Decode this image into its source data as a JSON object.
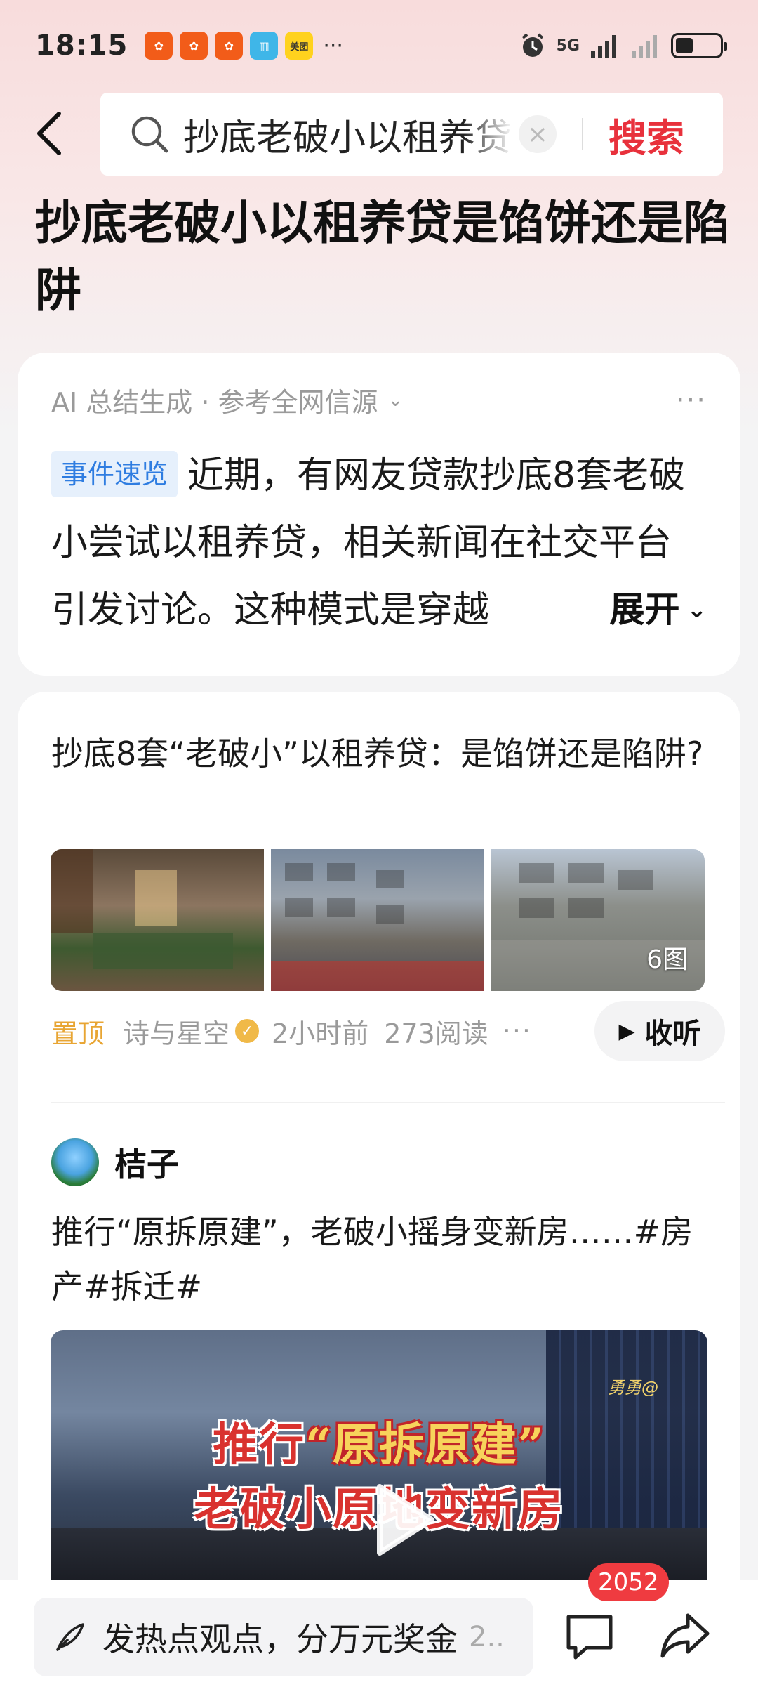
{
  "status_bar": {
    "time": "18:15",
    "app_icons": [
      {
        "name": "app-icon-1",
        "color": "#f25c19",
        "glyph": "✿"
      },
      {
        "name": "app-icon-2",
        "color": "#f25c19",
        "glyph": "✿"
      },
      {
        "name": "app-icon-3",
        "color": "#f25c19",
        "glyph": "✿"
      },
      {
        "name": "reader-icon",
        "color": "#3fb6e8",
        "glyph": "▥"
      },
      {
        "name": "meituan-icon",
        "color": "#ffd21e",
        "glyph": "美团"
      }
    ],
    "more": "···",
    "network": "5G",
    "battery_level": 0.4
  },
  "search": {
    "query": "抄底老破小以租养贷是馅饼还是陷阱",
    "button_label": "搜索"
  },
  "page_title": "抄底老破小以租养贷是馅饼还是陷阱",
  "ai_summary": {
    "source_label": "AI 总结生成 · 参考全网信源",
    "tag": "事件速览",
    "text": "近期，有网友贷款抄底8套老破小尝试以租养贷，相关新闻在社交平台引发讨论。这种模式是穿越",
    "expand_label": "展开"
  },
  "article": {
    "title": "抄底8套“老破小”以租养贷：是馅饼还是陷阱?",
    "image_count": "6图",
    "pin_label": "置顶",
    "author": "诗与星空",
    "time": "2小时前",
    "reads": "273阅读",
    "more": "···",
    "listen_label": "收听"
  },
  "post": {
    "user": "桔子",
    "text": "推行“原拆原建”，老破小摇身变新房……#房产#拆迁#",
    "video_caption_line1_a": "推行",
    "video_caption_line1_b": "“原拆原建”",
    "video_caption_line2": "老破小原地变新房",
    "video_watermark": "勇勇@"
  },
  "bottom_bar": {
    "comment_placeholder": "发热点观点，分万元奖金",
    "comment_trunc": "2..",
    "comment_count": "2052"
  },
  "colors": {
    "accent_red": "#e8313c",
    "tag_blue": "#2f7de1",
    "pin_orange": "#e8a533"
  }
}
